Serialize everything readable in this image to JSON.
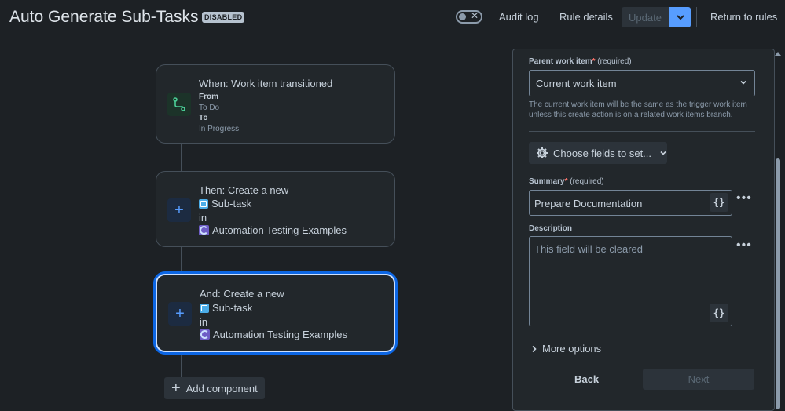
{
  "header": {
    "title": "Auto Generate Sub-Tasks",
    "status_badge": "DISABLED",
    "audit_log": "Audit log",
    "rule_details": "Rule details",
    "update": "Update",
    "return_to_rules": "Return to rules",
    "toggle_enabled": false
  },
  "flow": {
    "trigger": {
      "title": "When: Work item transitioned",
      "from_label": "From",
      "from_value": "To Do",
      "to_label": "To",
      "to_value": "In Progress"
    },
    "actions": [
      {
        "title": "Then: Create a new",
        "issue_type": "Sub-task",
        "in_label": "in",
        "project": "Automation Testing Examples"
      },
      {
        "title": "And: Create a new",
        "issue_type": "Sub-task",
        "in_label": "in",
        "project": "Automation Testing Examples",
        "selected": true
      }
    ],
    "add_component": "Add component"
  },
  "panel": {
    "parent_label": "Parent work item",
    "parent_required_star": "*",
    "parent_required_note": "(required)",
    "parent_value": "Current work item",
    "parent_helper": "The current work item will be the same as the trigger work item unless this create action is on a related work items branch.",
    "choose_fields": "Choose fields to set...",
    "summary_label": "Summary",
    "summary_required_star": "*",
    "summary_required_note": "(required)",
    "summary_value": "Prepare Documentation",
    "description_label": "Description",
    "description_placeholder": "This field will be cleared",
    "smart_value_icon": "{}",
    "more_icon": "•••",
    "more_options": "More options",
    "back": "Back",
    "next": "Next"
  },
  "colors": {
    "background": "#1d2125",
    "accent": "#579dff",
    "card_border": "#454f59",
    "selected_ring": "#0c66e4"
  }
}
